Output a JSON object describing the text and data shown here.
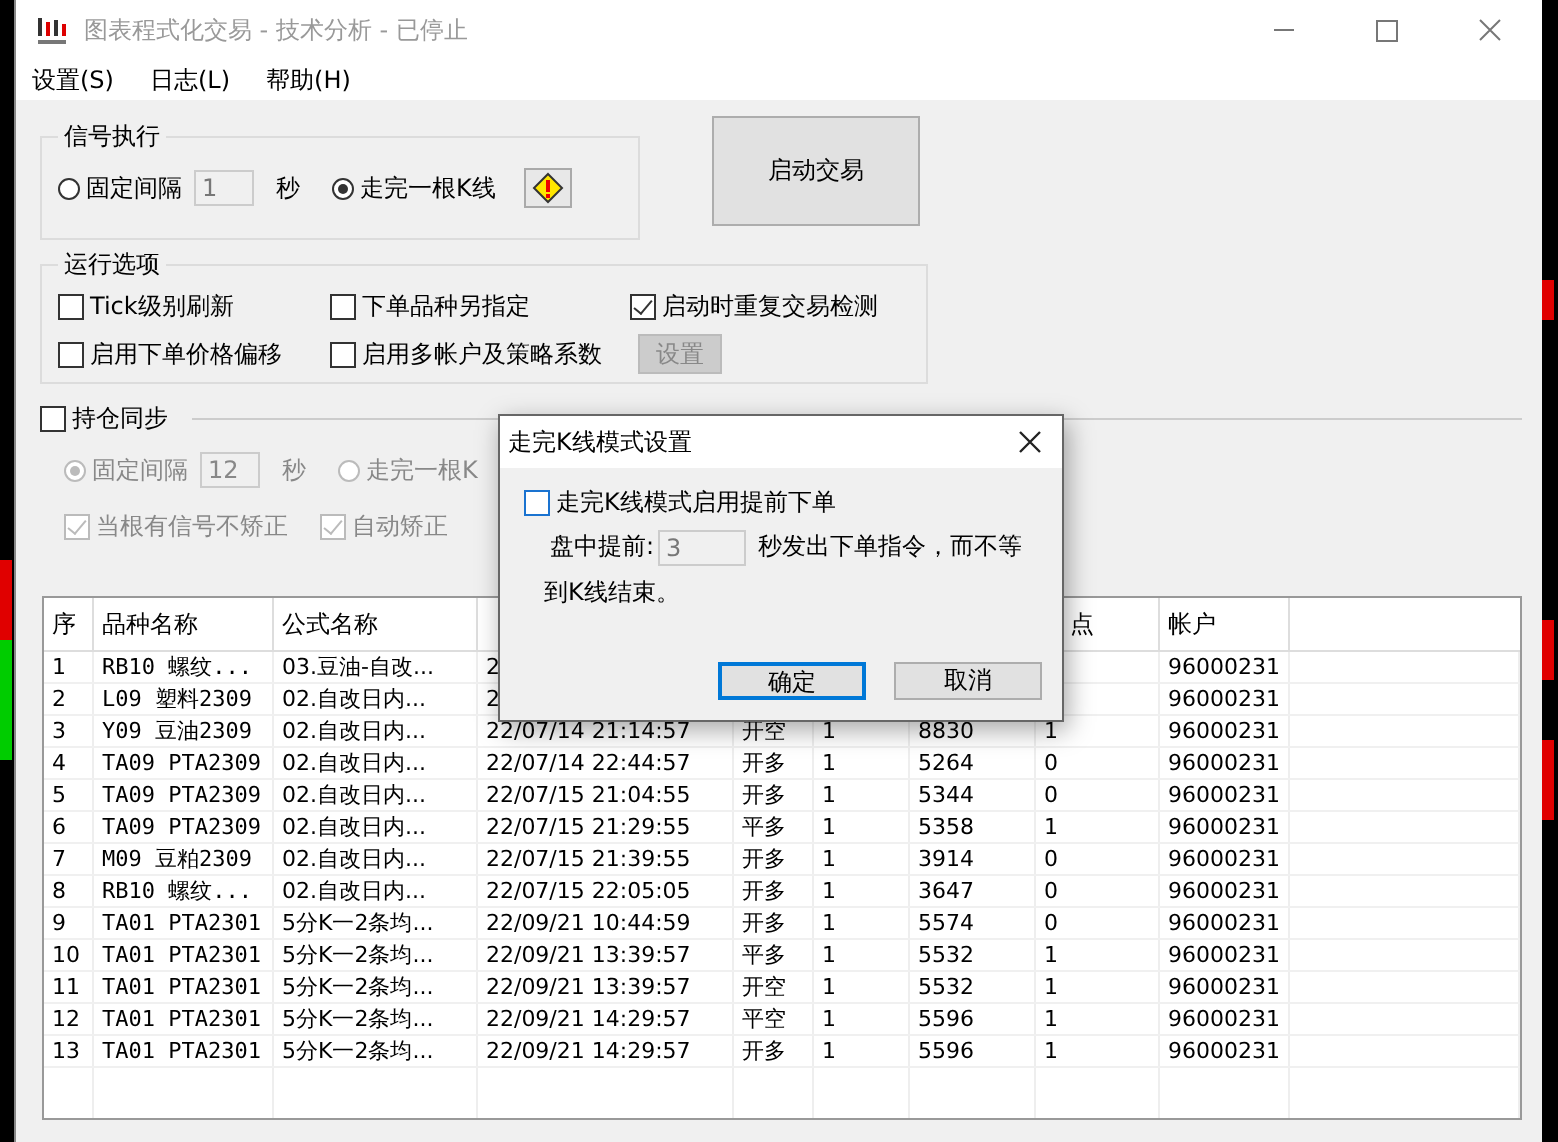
{
  "window": {
    "title": "图表程式化交易 - 技术分析 - 已停止"
  },
  "menu": [
    "设置(S)",
    "日志(L)",
    "帮助(H)"
  ],
  "signal_group": {
    "title": "信号执行",
    "interval": {
      "label": "固定间隔",
      "selected": false,
      "value": "1",
      "unit": "秒"
    },
    "bar": {
      "label": "走完一根K线",
      "selected": true
    }
  },
  "start_button": "启动交易",
  "run_options": {
    "title": "运行选项",
    "items": [
      {
        "label": "Tick级别刷新",
        "checked": false
      },
      {
        "label": "下单品种另指定",
        "checked": false
      },
      {
        "label": "启动时重复交易检测",
        "checked": true
      },
      {
        "label": "启用下单价格偏移",
        "checked": false
      },
      {
        "label": "启用多帐户及策略系数",
        "checked": false
      }
    ],
    "settings_button": {
      "label": "设置",
      "disabled": true
    }
  },
  "sync": {
    "label": "持仓同步",
    "checked": false,
    "disabled": true,
    "interval": {
      "label": "固定间隔",
      "selected": true,
      "value": "12",
      "unit": "秒"
    },
    "bar": {
      "label": "走完一根K",
      "selected": false
    },
    "checks": [
      {
        "label": "当根有信号不矫正",
        "checked": true
      },
      {
        "label": "自动矫正",
        "checked": true
      }
    ]
  },
  "table": {
    "columns": [
      "序",
      "品种名称",
      "公式名称",
      null,
      null,
      null,
      null,
      "点",
      "帐户"
    ],
    "rows": [
      [
        "1",
        "RB10 螺纹...",
        "03.豆油-自改...",
        "2",
        null,
        null,
        null,
        null,
        "96000231"
      ],
      [
        "2",
        "L09 塑料2309",
        "02.自改日内...",
        "2",
        null,
        null,
        null,
        null,
        "96000231"
      ],
      [
        "3",
        "Y09 豆油2309",
        "02.自改日内...",
        "22/07/14 21:14:57",
        "开空",
        "1",
        "8830",
        "1",
        "96000231"
      ],
      [
        "4",
        "TA09 PTA2309",
        "02.自改日内...",
        "22/07/14 22:44:57",
        "开多",
        "1",
        "5264",
        "0",
        "96000231"
      ],
      [
        "5",
        "TA09 PTA2309",
        "02.自改日内...",
        "22/07/15 21:04:55",
        "开多",
        "1",
        "5344",
        "0",
        "96000231"
      ],
      [
        "6",
        "TA09 PTA2309",
        "02.自改日内...",
        "22/07/15 21:29:55",
        "平多",
        "1",
        "5358",
        "1",
        "96000231"
      ],
      [
        "7",
        "M09 豆粕2309",
        "02.自改日内...",
        "22/07/15 21:39:55",
        "开多",
        "1",
        "3914",
        "0",
        "96000231"
      ],
      [
        "8",
        "RB10 螺纹...",
        "02.自改日内...",
        "22/07/15 22:05:05",
        "开多",
        "1",
        "3647",
        "0",
        "96000231"
      ],
      [
        "9",
        "TA01 PTA2301",
        "5分K一2条均...",
        "22/09/21 10:44:59",
        "开多",
        "1",
        "5574",
        "0",
        "96000231"
      ],
      [
        "10",
        "TA01 PTA2301",
        "5分K一2条均...",
        "22/09/21 13:39:57",
        "平多",
        "1",
        "5532",
        "1",
        "96000231"
      ],
      [
        "11",
        "TA01 PTA2301",
        "5分K一2条均...",
        "22/09/21 13:39:57",
        "开空",
        "1",
        "5532",
        "1",
        "96000231"
      ],
      [
        "12",
        "TA01 PTA2301",
        "5分K一2条均...",
        "22/09/21 14:29:57",
        "平空",
        "1",
        "5596",
        "1",
        "96000231"
      ],
      [
        "13",
        "TA01 PTA2301",
        "5分K一2条均...",
        "22/09/21 14:29:57",
        "开多",
        "1",
        "5596",
        "1",
        "96000231"
      ]
    ]
  },
  "dialog": {
    "title": "走完K线模式设置",
    "check": {
      "label": "走完K线模式启用提前下单",
      "checked": false
    },
    "lead_label": "盘中提前:",
    "lead_value": "3",
    "text_lines": [
      "秒发出下单指令，而不等",
      "到K线结束。"
    ],
    "ok": "确定",
    "cancel": "取消"
  }
}
